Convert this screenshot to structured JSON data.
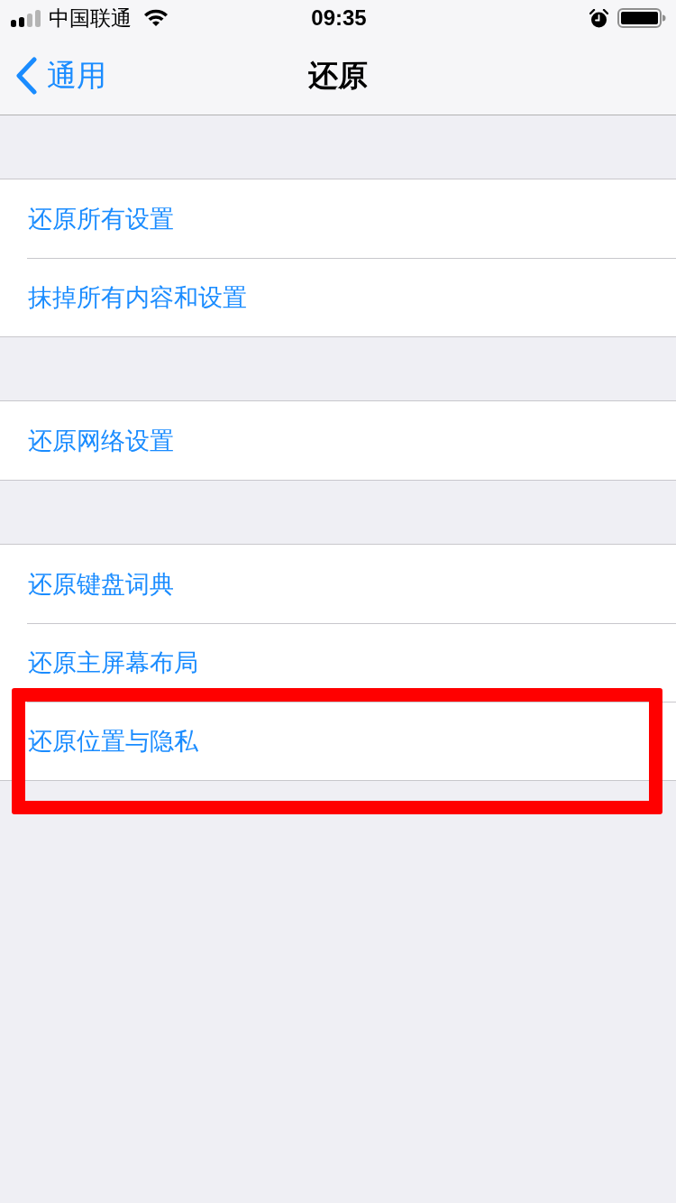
{
  "status_bar": {
    "carrier": "中国联通",
    "time": "09:35"
  },
  "nav_bar": {
    "back_label": "通用",
    "title": "还原"
  },
  "groups": [
    {
      "items": [
        {
          "label": "还原所有设置",
          "highlighted": false
        },
        {
          "label": "抹掉所有内容和设置",
          "highlighted": false
        }
      ]
    },
    {
      "items": [
        {
          "label": "还原网络设置",
          "highlighted": false
        }
      ]
    },
    {
      "items": [
        {
          "label": "还原键盘词典",
          "highlighted": false
        },
        {
          "label": "还原主屏幕布局",
          "highlighted": false
        },
        {
          "label": "还原位置与隐私",
          "highlighted": true
        }
      ]
    }
  ]
}
